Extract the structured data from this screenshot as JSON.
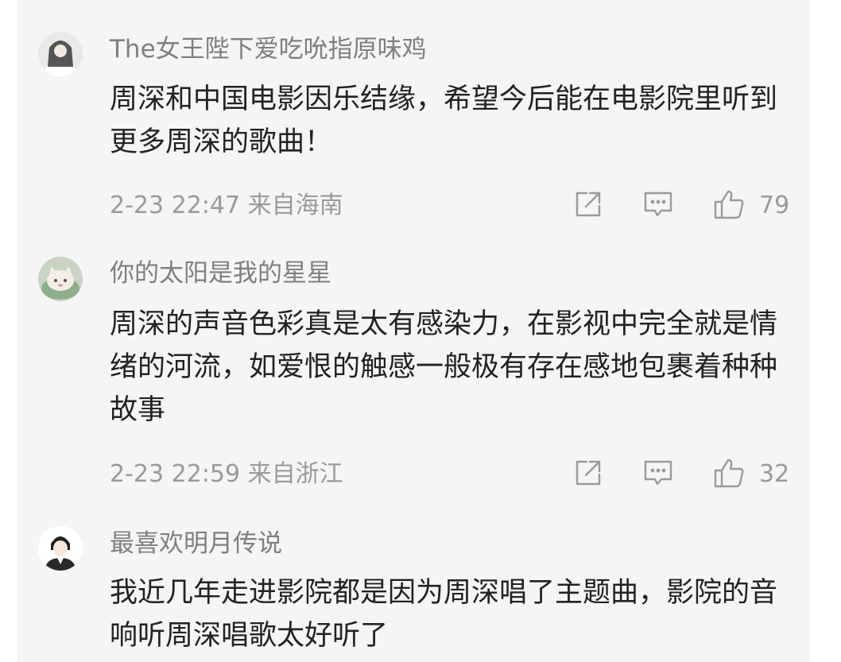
{
  "colors": {
    "panel_bg": "#f5f5f5",
    "username": "#7f7f7f",
    "body_text": "#222222",
    "meta_text": "#9a9a9a",
    "icon_stroke": "#9a9a9a"
  },
  "comments": [
    {
      "username": "The女王陛下爱吃吮指原味鸡",
      "text": "周深和中国电影因乐结缘，希望今后能在电影院里听到更多周深的歌曲！",
      "time": "2-23 22:47",
      "location": "来自海南",
      "likes": "79",
      "icons": [
        "share-icon",
        "comment-icon",
        "thumbs-up-icon"
      ]
    },
    {
      "username": "你的太阳是我的星星",
      "text": "周深的声音色彩真是太有感染力，在影视中完全就是情绪的河流，如爱恨的触感一般极有存在感地包裹着种种故事",
      "time": "2-23 22:59",
      "location": "来自浙江",
      "likes": "32",
      "icons": [
        "share-icon",
        "comment-icon",
        "thumbs-up-icon"
      ]
    },
    {
      "username": "最喜欢明月传说",
      "text": "我近几年走进影院都是因为周深唱了主题曲，影院的音响听周深唱歌太好听了"
    }
  ]
}
